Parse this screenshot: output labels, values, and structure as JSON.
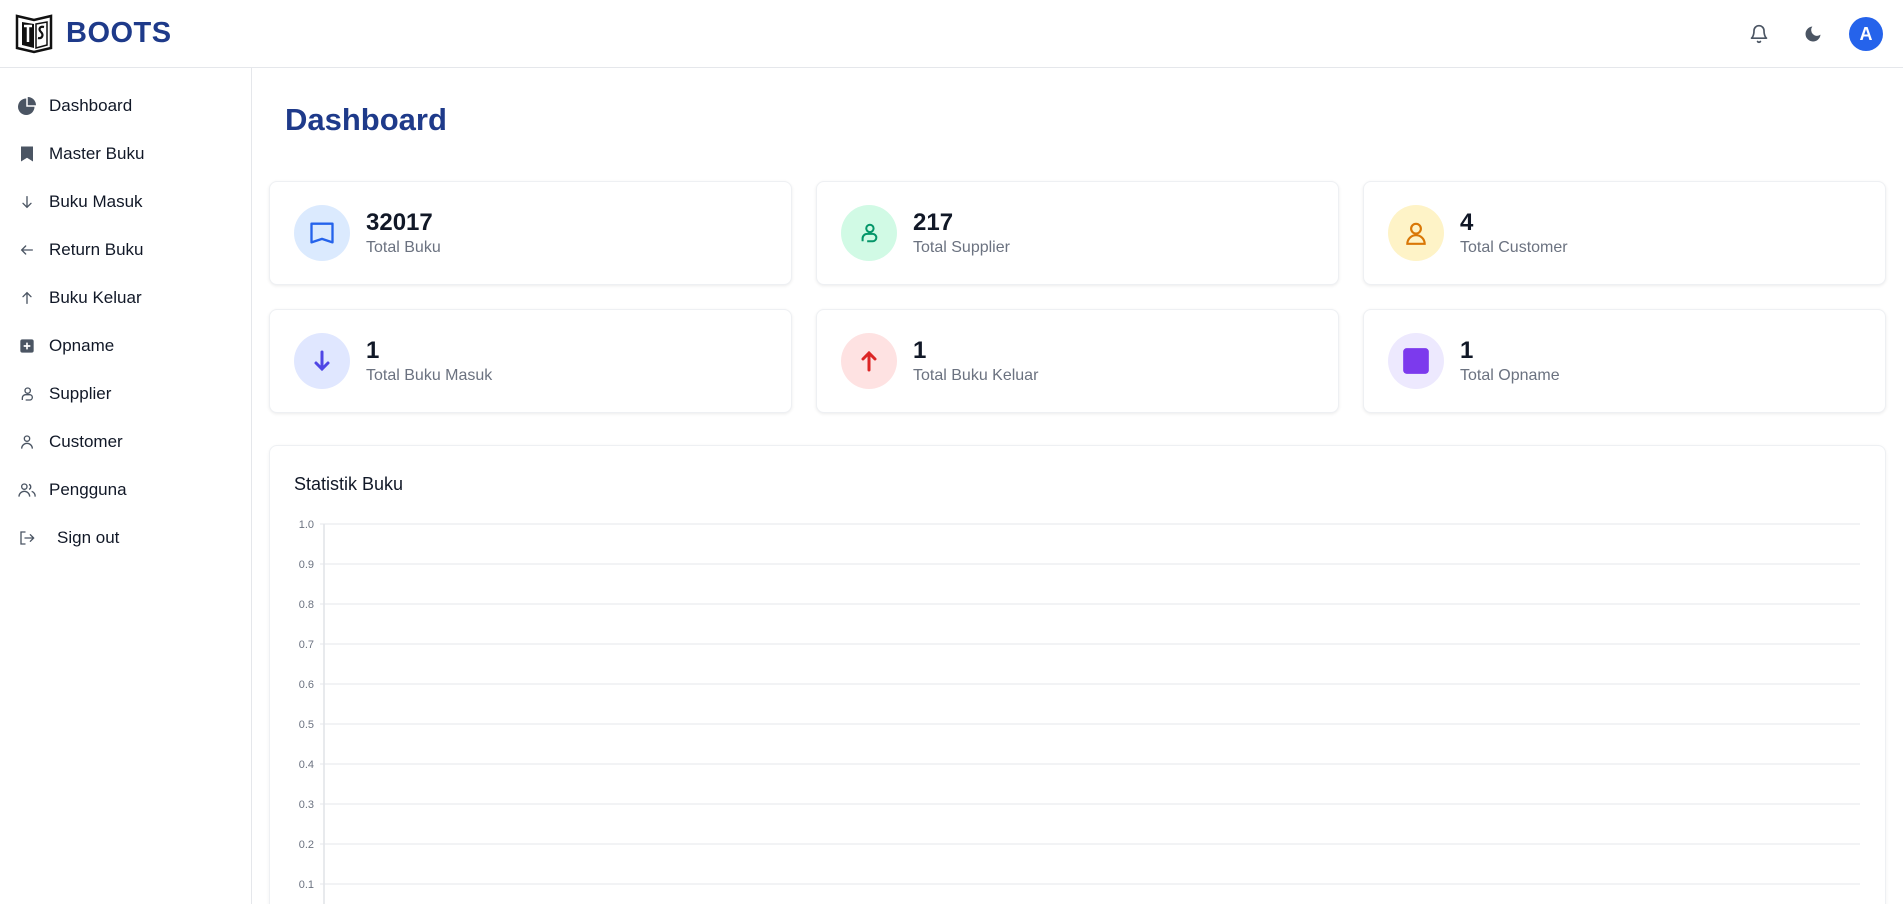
{
  "header": {
    "brand": "BOOTS",
    "avatar_initial": "A",
    "icons": [
      "bell-icon",
      "moon-icon"
    ]
  },
  "sidebar": {
    "items": [
      {
        "label": "Dashboard",
        "icon": "pie-chart-icon"
      },
      {
        "label": "Master Buku",
        "icon": "bookmark-icon"
      },
      {
        "label": "Buku Masuk",
        "icon": "arrow-down-icon"
      },
      {
        "label": "Return Buku",
        "icon": "arrow-left-icon"
      },
      {
        "label": "Buku Keluar",
        "icon": "arrow-up-icon"
      },
      {
        "label": "Opname",
        "icon": "plus-square-icon"
      },
      {
        "label": "Supplier",
        "icon": "supplier-icon"
      },
      {
        "label": "Customer",
        "icon": "user-icon"
      },
      {
        "label": "Pengguna",
        "icon": "users-icon"
      },
      {
        "label": "Sign out",
        "icon": "sign-out-icon"
      }
    ]
  },
  "main": {
    "title": "Dashboard",
    "stats": [
      {
        "value": "32017",
        "label": "Total Buku",
        "icon": "book-icon",
        "color": "#2563eb",
        "bg": "#dbeafe"
      },
      {
        "value": "217",
        "label": "Total Supplier",
        "icon": "supplier-icon",
        "color": "#059669",
        "bg": "#d1fae5"
      },
      {
        "value": "4",
        "label": "Total Customer",
        "icon": "user-icon",
        "color": "#d97706",
        "bg": "#fef3c7"
      },
      {
        "value": "1",
        "label": "Total Buku Masuk",
        "icon": "arrow-down-icon",
        "color": "#4f46e5",
        "bg": "#e0e7ff"
      },
      {
        "value": "1",
        "label": "Total Buku Keluar",
        "icon": "arrow-up-icon",
        "color": "#dc2626",
        "bg": "#fee2e2"
      },
      {
        "value": "1",
        "label": "Total Opname",
        "icon": "square-icon",
        "color": "#7c3aed",
        "bg": "#ede9fe"
      }
    ]
  },
  "chart_data": {
    "type": "line",
    "title": "Statistik Buku",
    "ylim": [
      0,
      1
    ],
    "yticks": [
      "1.0",
      "0.9",
      "0.8",
      "0.7",
      "0.6",
      "0.5",
      "0.4",
      "0.3",
      "0.2",
      "0.1"
    ],
    "series": [],
    "grid": true
  }
}
